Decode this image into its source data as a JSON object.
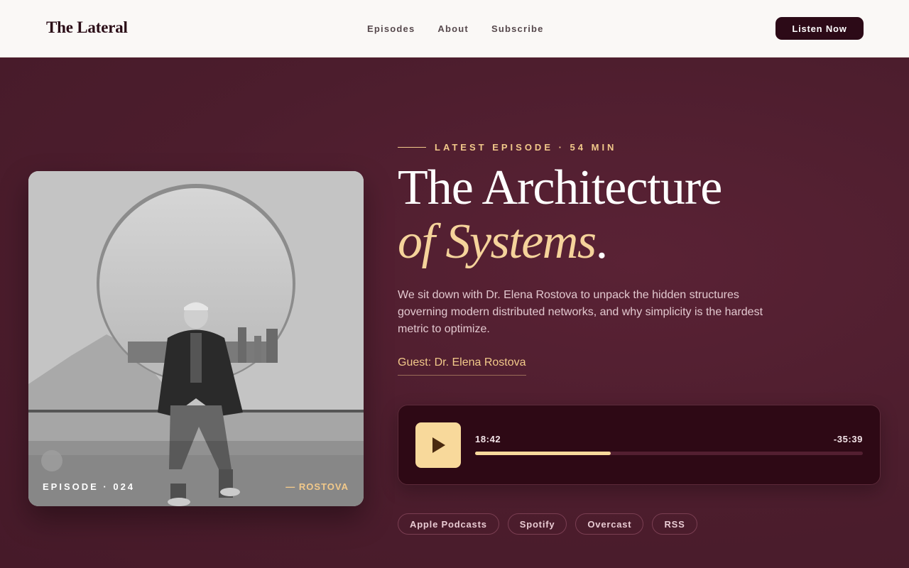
{
  "header": {
    "logo": "The Lateral",
    "nav": [
      "Episodes",
      "About",
      "Subscribe"
    ],
    "cta": "Listen Now"
  },
  "artwork": {
    "episode_label": "EPISODE · 024",
    "guest_tag": "— ROSTOVA"
  },
  "episode": {
    "kicker": "LATEST EPISODE · 54 MIN",
    "title_line1": "The Architecture",
    "title_line2": "of Systems",
    "title_punct": ".",
    "description": "We sit down with Dr. Elena Rostova to unpack the hidden structures governing modern distributed networks, and why simplicity is the hardest metric to optimize.",
    "guest": "Guest: Dr. Elena Rostova"
  },
  "player": {
    "elapsed": "18:42",
    "remaining": "-35:39",
    "progress_fraction": 0.35
  },
  "platforms": [
    "Apple Podcasts",
    "Spotify",
    "Overcast",
    "RSS"
  ],
  "colors": {
    "background": "#4c1d2d",
    "accent": "#f5d39b",
    "header_bg": "#faf8f6",
    "button_dark": "#2c0a17"
  }
}
